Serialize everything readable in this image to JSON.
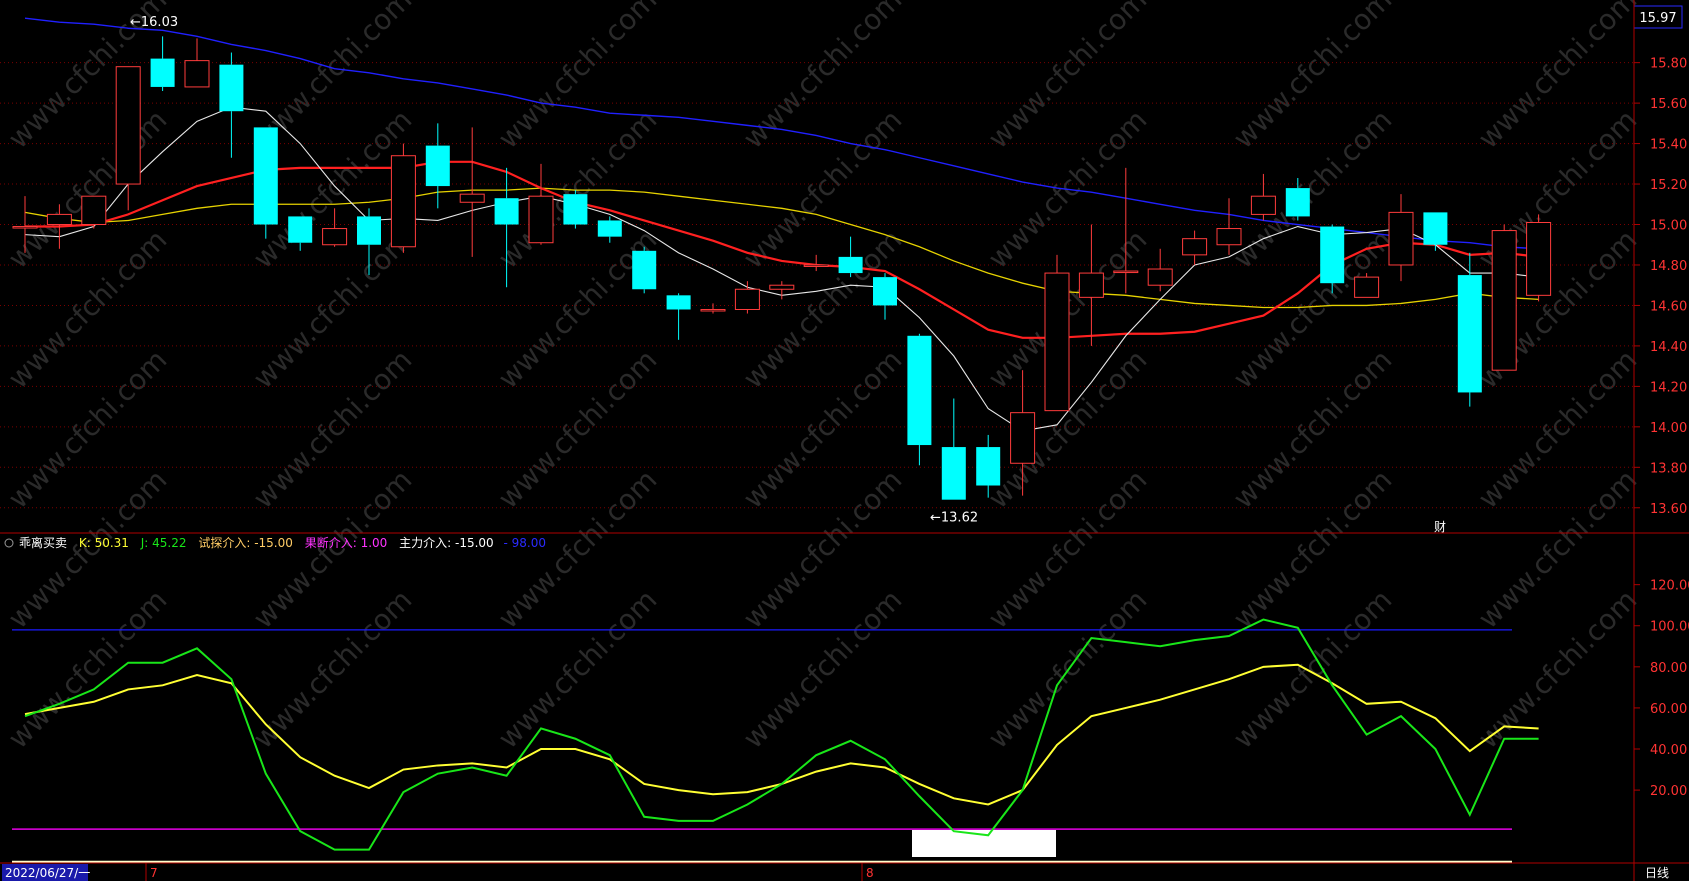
{
  "colors": {
    "up": "#ff3c3c",
    "down": "#00ffff",
    "ma5": "#e8e8e8",
    "ma10": "#ff2020",
    "ma20": "#e6d200",
    "ma60": "#2020ff",
    "grid": "#7a0000",
    "axis_text": "#ff3333",
    "k_line": "#ffff33",
    "j_line": "#19e619",
    "magenta": "#e600e6",
    "blue_line": "#1a1aff"
  },
  "top_right_price": "15.97",
  "price_axis_ticks": [
    "15.80",
    "15.60",
    "15.40",
    "15.20",
    "15.00",
    "14.80",
    "14.60",
    "14.40",
    "14.20",
    "14.00",
    "13.80",
    "13.60"
  ],
  "annotations": {
    "high_label": "16.03",
    "low_label": "13.62",
    "cai_badge": "财"
  },
  "indicator_legend": {
    "name": "乖离买卖",
    "k": "K: 50.31",
    "j": "J: 45.22",
    "trial": "试探介入: -15.00",
    "decisive": "果断介入: 1.00",
    "main": "主力介入: -15.00",
    "last": "- 98.00"
  },
  "indicator_axis_ticks": [
    "120.00",
    "100.00",
    "80.00",
    "60.00",
    "40.00",
    "20.00"
  ],
  "date_label": "2022/06/27/一",
  "month_markers": [
    "7",
    "8"
  ],
  "period_label": "日线",
  "chart_data": [
    {
      "type": "candlestick",
      "ylim": [
        13.5,
        16.08
      ],
      "high_marker": 16.03,
      "low_marker": 13.62,
      "candles": [
        {
          "o": 14.99,
          "h": 15.14,
          "l": 14.86,
          "c": 14.99
        },
        {
          "o": 15.0,
          "h": 15.1,
          "l": 14.88,
          "c": 15.05
        },
        {
          "o": 15.0,
          "h": 15.12,
          "l": 14.98,
          "c": 15.14
        },
        {
          "o": 15.2,
          "h": 15.36,
          "l": 15.07,
          "c": 15.78
        },
        {
          "o": 15.82,
          "h": 15.93,
          "l": 15.66,
          "c": 15.68
        },
        {
          "o": 15.68,
          "h": 15.92,
          "l": 15.68,
          "c": 15.81
        },
        {
          "o": 15.79,
          "h": 15.85,
          "l": 15.33,
          "c": 15.56
        },
        {
          "o": 15.48,
          "h": 15.48,
          "l": 14.93,
          "c": 15.0
        },
        {
          "o": 15.04,
          "h": 15.04,
          "l": 14.87,
          "c": 14.91
        },
        {
          "o": 14.9,
          "h": 15.08,
          "l": 14.89,
          "c": 14.98
        },
        {
          "o": 15.04,
          "h": 15.08,
          "l": 14.75,
          "c": 14.9
        },
        {
          "o": 14.89,
          "h": 15.4,
          "l": 14.86,
          "c": 15.34
        },
        {
          "o": 15.39,
          "h": 15.5,
          "l": 15.08,
          "c": 15.19
        },
        {
          "o": 15.11,
          "h": 15.48,
          "l": 14.84,
          "c": 15.15
        },
        {
          "o": 15.13,
          "h": 15.28,
          "l": 14.69,
          "c": 15.0
        },
        {
          "o": 14.91,
          "h": 15.3,
          "l": 14.9,
          "c": 15.14
        },
        {
          "o": 15.15,
          "h": 15.17,
          "l": 14.98,
          "c": 15.0
        },
        {
          "o": 15.02,
          "h": 15.04,
          "l": 14.91,
          "c": 14.94
        },
        {
          "o": 14.87,
          "h": 14.89,
          "l": 14.66,
          "c": 14.68
        },
        {
          "o": 14.65,
          "h": 14.66,
          "l": 14.43,
          "c": 14.58
        },
        {
          "o": 14.58,
          "h": 14.61,
          "l": 14.56,
          "c": 14.58
        },
        {
          "o": 14.58,
          "h": 14.72,
          "l": 14.56,
          "c": 14.68
        },
        {
          "o": 14.68,
          "h": 14.72,
          "l": 14.63,
          "c": 14.7
        },
        {
          "o": 14.8,
          "h": 14.85,
          "l": 14.77,
          "c": 14.8
        },
        {
          "o": 14.84,
          "h": 14.94,
          "l": 14.74,
          "c": 14.76
        },
        {
          "o": 14.74,
          "h": 14.76,
          "l": 14.53,
          "c": 14.6
        },
        {
          "o": 14.45,
          "h": 14.46,
          "l": 13.81,
          "c": 13.91
        },
        {
          "o": 13.9,
          "h": 14.14,
          "l": 13.64,
          "c": 13.64
        },
        {
          "o": 13.9,
          "h": 13.96,
          "l": 13.65,
          "c": 13.71
        },
        {
          "o": 13.82,
          "h": 14.28,
          "l": 13.66,
          "c": 14.07
        },
        {
          "o": 14.08,
          "h": 14.85,
          "l": 14.08,
          "c": 14.76
        },
        {
          "o": 14.64,
          "h": 15.0,
          "l": 14.4,
          "c": 14.76
        },
        {
          "o": 14.77,
          "h": 15.28,
          "l": 14.66,
          "c": 14.77
        },
        {
          "o": 14.7,
          "h": 14.88,
          "l": 14.67,
          "c": 14.78
        },
        {
          "o": 14.85,
          "h": 14.97,
          "l": 14.8,
          "c": 14.93
        },
        {
          "o": 14.9,
          "h": 15.13,
          "l": 14.85,
          "c": 14.98
        },
        {
          "o": 15.05,
          "h": 15.25,
          "l": 15.02,
          "c": 15.14
        },
        {
          "o": 15.18,
          "h": 15.23,
          "l": 15.02,
          "c": 15.04
        },
        {
          "o": 14.99,
          "h": 15.0,
          "l": 14.66,
          "c": 14.71
        },
        {
          "o": 14.64,
          "h": 14.76,
          "l": 14.64,
          "c": 14.74
        },
        {
          "o": 14.8,
          "h": 15.15,
          "l": 14.72,
          "c": 15.06
        },
        {
          "o": 15.06,
          "h": 15.06,
          "l": 14.87,
          "c": 14.9
        },
        {
          "o": 14.75,
          "h": 14.86,
          "l": 14.1,
          "c": 14.17
        },
        {
          "o": 14.28,
          "h": 15.0,
          "l": 14.28,
          "c": 14.97
        },
        {
          "o": 14.65,
          "h": 15.05,
          "l": 14.62,
          "c": 15.01
        }
      ],
      "ma5": [
        14.95,
        14.94,
        14.99,
        15.2,
        15.36,
        15.51,
        15.58,
        15.56,
        15.4,
        15.19,
        15.02,
        15.03,
        15.02,
        15.07,
        15.11,
        15.14,
        15.1,
        15.05,
        14.97,
        14.86,
        14.78,
        14.69,
        14.65,
        14.67,
        14.7,
        14.69,
        14.54,
        14.35,
        14.09,
        13.98,
        14.01,
        14.22,
        14.45,
        14.63,
        14.8,
        14.84,
        14.93,
        14.99,
        14.95,
        14.96,
        14.98,
        14.9,
        14.76,
        14.76,
        14.74
      ],
      "ma10": [
        14.99,
        14.99,
        15.0,
        15.05,
        15.12,
        15.19,
        15.23,
        15.27,
        15.28,
        15.28,
        15.28,
        15.28,
        15.31,
        15.31,
        15.26,
        15.18,
        15.11,
        15.07,
        15.02,
        14.97,
        14.92,
        14.86,
        14.82,
        14.8,
        14.79,
        14.77,
        14.68,
        14.58,
        14.48,
        14.44,
        14.44,
        14.45,
        14.46,
        14.46,
        14.47,
        14.51,
        14.55,
        14.66,
        14.8,
        14.88,
        14.91,
        14.9,
        14.85,
        14.86,
        14.84
      ],
      "ma20": [
        15.06,
        15.03,
        15.01,
        15.02,
        15.05,
        15.08,
        15.1,
        15.1,
        15.1,
        15.1,
        15.11,
        15.13,
        15.16,
        15.17,
        15.17,
        15.18,
        15.17,
        15.17,
        15.16,
        15.14,
        15.12,
        15.1,
        15.08,
        15.05,
        15.0,
        14.95,
        14.89,
        14.82,
        14.76,
        14.71,
        14.67,
        14.66,
        14.65,
        14.63,
        14.61,
        14.6,
        14.59,
        14.59,
        14.6,
        14.6,
        14.61,
        14.63,
        14.66,
        14.64,
        14.63
      ],
      "ma60": [
        16.02,
        16.0,
        15.99,
        15.97,
        15.96,
        15.93,
        15.89,
        15.86,
        15.82,
        15.77,
        15.75,
        15.72,
        15.7,
        15.67,
        15.64,
        15.6,
        15.58,
        15.55,
        15.54,
        15.53,
        15.51,
        15.49,
        15.47,
        15.44,
        15.4,
        15.37,
        15.33,
        15.29,
        15.25,
        15.21,
        15.18,
        15.16,
        15.13,
        15.1,
        15.07,
        15.05,
        15.02,
        15.0,
        14.98,
        14.96,
        14.94,
        14.92,
        14.91,
        14.89,
        14.88
      ]
    },
    {
      "type": "line",
      "ylim": [
        -15,
        132
      ],
      "series": [
        {
          "name": "K",
          "values": [
            57,
            60,
            63,
            69,
            71,
            76,
            72,
            52,
            36,
            27,
            21,
            30,
            32,
            33,
            31,
            40,
            40,
            35,
            23,
            20,
            18,
            19,
            23,
            29,
            33,
            31,
            23,
            16,
            13,
            20,
            42,
            56,
            60,
            64,
            69,
            74,
            80,
            81,
            72,
            62,
            63,
            55,
            39,
            51,
            50
          ]
        },
        {
          "name": "J",
          "values": [
            56,
            62,
            69,
            82,
            82,
            89,
            74,
            28,
            0,
            -9,
            -9,
            19,
            28,
            31,
            27,
            50,
            45,
            37,
            7,
            5,
            5,
            13,
            23,
            37,
            44,
            35,
            17,
            0,
            -2,
            20,
            71,
            94,
            92,
            90,
            93,
            95,
            103,
            99,
            71,
            47,
            56,
            40,
            8,
            45,
            45
          ]
        }
      ],
      "reference_lines": [
        98,
        1,
        -15
      ]
    }
  ]
}
